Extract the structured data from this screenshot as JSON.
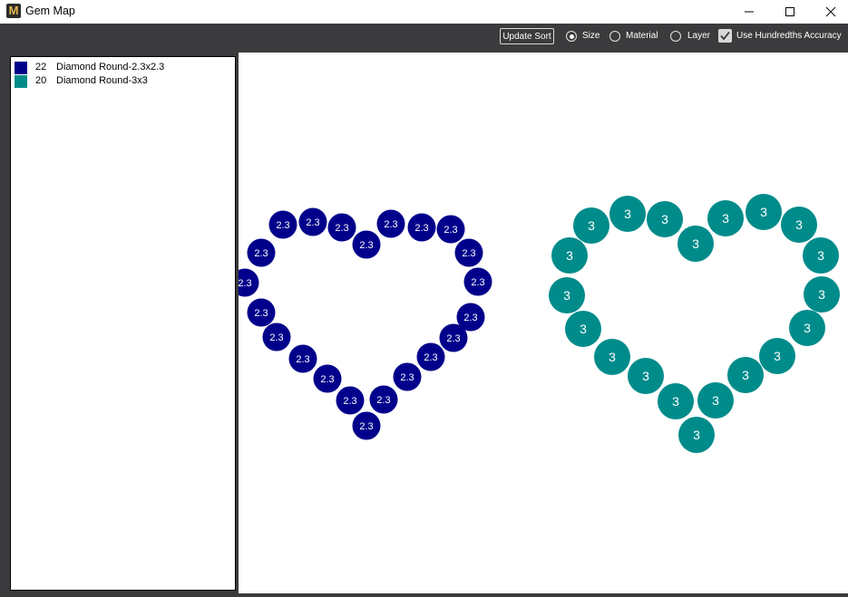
{
  "window": {
    "title": "Gem Map",
    "app_icon": "M"
  },
  "toolbar": {
    "update_button": "Update Sort",
    "sort_options": [
      {
        "label": "Size",
        "selected": true
      },
      {
        "label": "Material",
        "selected": false
      },
      {
        "label": "Layer",
        "selected": false
      }
    ],
    "hundredths_checkbox": {
      "label": "Use Hundredths Accuracy",
      "checked": true
    }
  },
  "legend": [
    {
      "count": "22",
      "name": "Diamond Round-2.3x2.3",
      "color": "#00008b"
    },
    {
      "count": "20",
      "name": "Diamond Round-3x3",
      "color": "#008b8b"
    }
  ],
  "gem_groups": [
    {
      "label": "2.3",
      "color": "#00008b",
      "count": 22
    },
    {
      "label": "3",
      "color": "#008b8b",
      "count": 20
    }
  ]
}
